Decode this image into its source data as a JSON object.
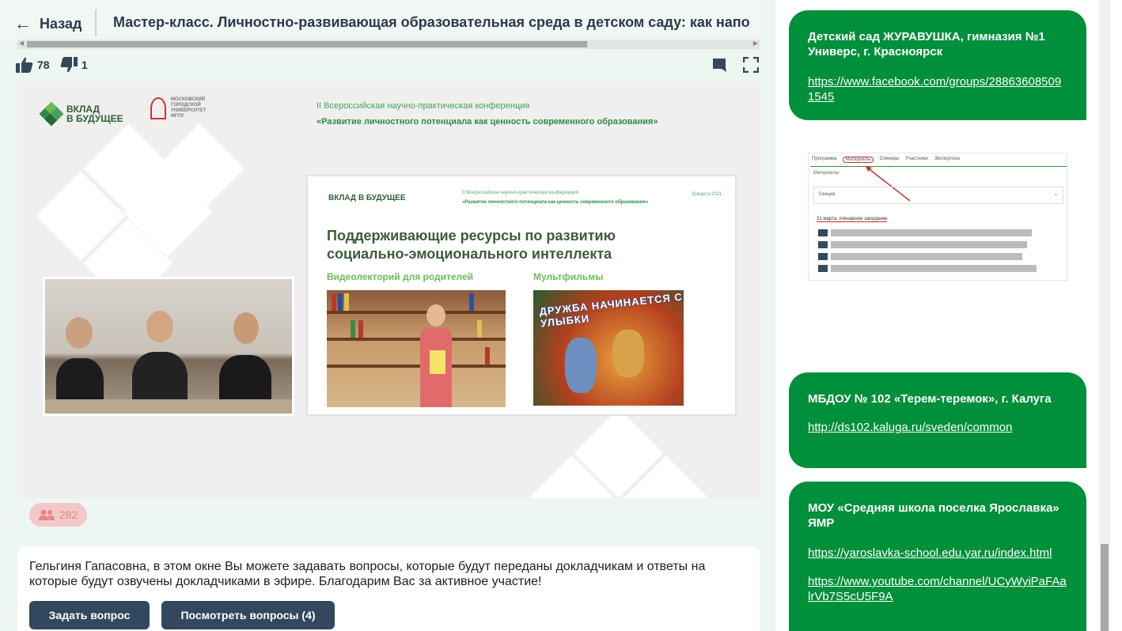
{
  "header": {
    "back_label": "Назад",
    "title": "Мастер-класс. Личностно-развивающая образовательная среда в детском саду: как напо"
  },
  "ratings": {
    "likes": "78",
    "dislikes": "1"
  },
  "video": {
    "logo_text_1": "ВКЛАД",
    "logo_text_2": "В БУДУЩЕЕ",
    "logo2_text": "МОСКОВСКИЙ ГОРОДСКОЙ УНИВЕРСИТЕТ МГПУ",
    "conference_line": "II Всероссийская научно-практическая конференция",
    "conference_title": "«Развитие личностного потенциала как ценность современного образования»",
    "slide": {
      "logo": "ВКЛАД В БУДУЩЕЕ",
      "conf_line": "II Всероссийская научно-практическая конференция",
      "conf_title": "«Развитие личностного потенциала как ценность современного образования»",
      "date": "31марта 2021",
      "heading_1": "Поддерживающие ресурсы по развитию",
      "heading_2": "социально-эмоционального интеллекта",
      "col1": "Видеолекторий для родителей",
      "col2": "Мультфильмы",
      "cartoon_caption": "ДРУЖБА НАЧИНАЕТСЯ С УЛЫБКИ"
    }
  },
  "viewers": {
    "count": "282"
  },
  "questions": {
    "text": "Гельгиня Гапасовна, в этом окне Вы можете задавать вопросы, которые будут переданы докладчикам и ответы на которые будут озвучены докладчиками в эфире. Благодарим Вас за активное участие!",
    "ask_button": "Задать вопрос",
    "view_button": "Посмотреть вопросы (4)"
  },
  "sidebar": {
    "cards": [
      {
        "title": "Детский сад ЖУРАВУШКА, гимназия №1 Универс, г. Красноярск",
        "links": [
          "https://www.facebook.com/groups/288636085091545"
        ]
      },
      {
        "title": "МБДОУ № 102 «Терем-теремок», г. Калуга",
        "links": [
          "http://ds102.kaluga.ru/sveden/common "
        ]
      },
      {
        "title": "МОУ «Средняя школа поселка Ярославка» ЯМР",
        "links": [
          "https://yaroslavka-school.edu.yar.ru/index.html",
          "https://www.youtube.com/channel/UCyWyiPaFAalrVb7S5cU5F9A"
        ]
      }
    ],
    "screenshot": {
      "tabs": [
        "Программа",
        "Материалы",
        "Спикеры",
        "Участники",
        "Экспертиза"
      ],
      "label": "Материалы",
      "section": "Секция",
      "rows_header": "31 марта, пленарное заседание"
    }
  },
  "colors": {
    "accent_green": "#008f3a",
    "button_dark": "#33485e",
    "viewers_badge": "#f2c9c8"
  }
}
